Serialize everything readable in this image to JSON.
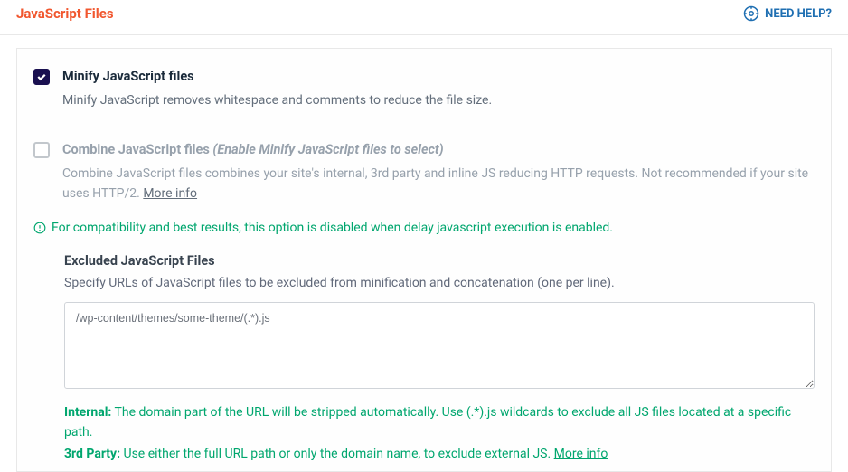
{
  "header": {
    "title": "JavaScript Files",
    "help_label": "NEED HELP?"
  },
  "options": {
    "minify": {
      "title": "Minify JavaScript files",
      "desc": "Minify JavaScript removes whitespace and comments to reduce the file size."
    },
    "combine": {
      "title": "Combine JavaScript files",
      "hint": "(Enable Minify JavaScript files to select)",
      "desc": "Combine JavaScript files combines your site's internal, 3rd party and inline JS reducing HTTP requests. Not recommended if your site uses HTTP/2.",
      "more_info": "More info"
    }
  },
  "notice": "For compatibility and best results, this option is disabled when delay javascript execution is enabled.",
  "excluded": {
    "title": "Excluded JavaScript Files",
    "desc": "Specify URLs of JavaScript files to be excluded from minification and concatenation (one per line).",
    "value": "/wp-content/themes/some-theme/(.*).js",
    "internal_label": "Internal:",
    "internal_text": " The domain part of the URL will be stripped automatically. Use (.*).js wildcards to exclude all JS files located at a specific path.",
    "third_label": "3rd Party:",
    "third_text": " Use either the full URL path or only the domain name, to exclude external JS. ",
    "more_info": "More info"
  }
}
